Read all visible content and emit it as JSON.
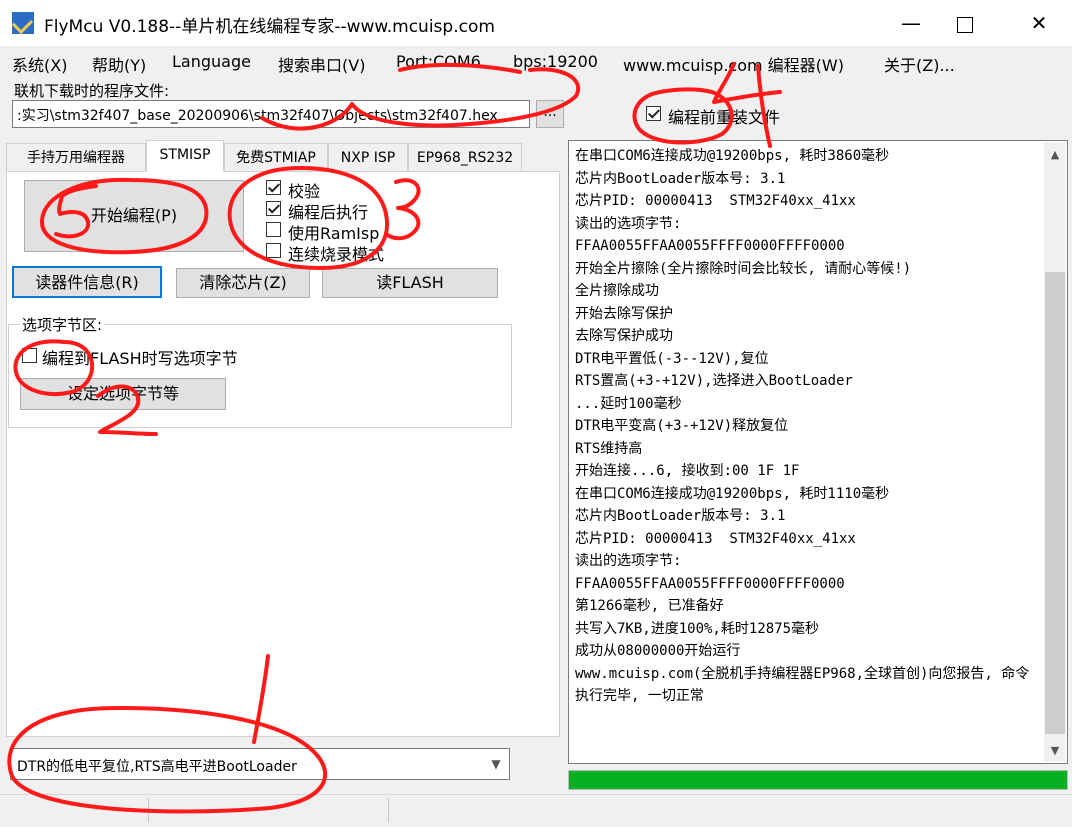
{
  "window": {
    "title": "FlyMcu V0.188--单片机在线编程专家--www.mcuisp.com",
    "minimize": "—",
    "close": "✕"
  },
  "menu": [
    "系统(X)",
    "帮助(Y)",
    "Language",
    "搜索串口(V)",
    "Port:COM6",
    "bps:19200",
    "www.mcuisp.com 编程器(W)",
    "关于(Z)..."
  ],
  "file": {
    "label": "联机下载时的程序文件:",
    "path": ":实习\\stm32f407_base_20200906\\stm32f407\\Objects\\stm32f407.hex",
    "browse": "...",
    "reload_label": "编程前重装文件",
    "reload_checked": true
  },
  "tabs": [
    "手持万用编程器",
    "STMISP",
    "免费STMIAP",
    "NXP ISP",
    "EP968_RS232"
  ],
  "active_tab": 1,
  "stmisp": {
    "start_button": "开始编程(P)",
    "options": [
      {
        "label": "校验",
        "checked": true
      },
      {
        "label": "编程后执行",
        "checked": true
      },
      {
        "label": "使用RamIsp",
        "checked": false
      },
      {
        "label": "连续烧录模式",
        "checked": false
      }
    ],
    "read_info_button": "读器件信息(R)",
    "erase_button": "清除芯片(Z)",
    "read_flash_button": "读FLASH",
    "option_bytes": {
      "title": "选项字节区:",
      "write_label": "编程到FLASH时写选项字节",
      "write_checked": false,
      "set_button": "设定选项字节等"
    },
    "reset_mode": "DTR的低电平复位,RTS高电平进BootLoader"
  },
  "log": [
    "在串口COM6连接成功@19200bps, 耗时3860毫秒",
    "芯片内BootLoader版本号: 3.1",
    "芯片PID: 00000413  STM32F40xx_41xx",
    "读出的选项字节:",
    "FFAA0055FFAA0055FFFF0000FFFF0000",
    "开始全片擦除(全片擦除时间会比较长, 请耐心等候!)",
    "全片擦除成功",
    "开始去除写保护",
    "去除写保护成功",
    "DTR电平置低(-3--12V),复位",
    "RTS置高(+3-+12V),选择进入BootLoader",
    "...延时100毫秒",
    "DTR电平变高(+3-+12V)释放复位",
    "RTS维持高",
    "开始连接...6, 接收到:00 1F 1F",
    "在串口COM6连接成功@19200bps, 耗时1110毫秒",
    "芯片内BootLoader版本号: 3.1",
    "芯片PID: 00000413  STM32F40xx_41xx",
    "读出的选项字节:",
    "FFAA0055FFAA0055FFFF0000FFFF0000",
    "第1266毫秒, 已准备好",
    "共写入7KB,进度100%,耗时12875毫秒",
    "成功从08000000开始运行",
    "www.mcuisp.com(全脱机手持编程器EP968,全球首创)向您报告, 命令执行完毕, 一切正常"
  ],
  "progress": 1.0,
  "colors": {
    "progress": "#06b025",
    "annotation": "#ff1a1a",
    "focus_border": "#0078d7"
  },
  "annotations": [
    "1",
    "2",
    "3",
    "4",
    "5"
  ]
}
